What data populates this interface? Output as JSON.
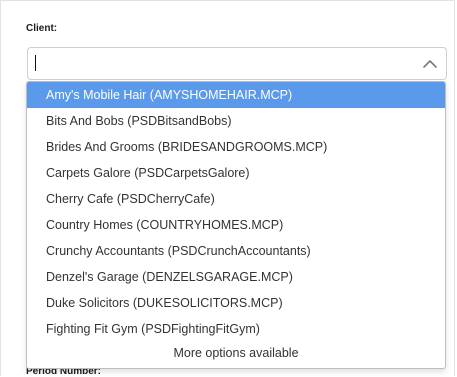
{
  "client_field": {
    "label": "Client:",
    "input_value": ""
  },
  "dropdown": {
    "selected_index": 0,
    "options": [
      "Amy's Mobile Hair (AMYSHOMEHAIR.MCP)",
      "Bits And Bobs (PSDBitsandBobs)",
      "Brides And Grooms (BRIDESANDGROOMS.MCP)",
      "Carpets Galore (PSDCarpetsGalore)",
      "Cherry Cafe (PSDCherryCafe)",
      "Country Homes (COUNTRYHOMES.MCP)",
      "Crunchy Accountants (PSDCrunchAccountants)",
      "Denzel's Garage (DENZELSGARAGE.MCP)",
      "Duke Solicitors (DUKESOLICITORS.MCP)",
      "Fighting Fit Gym (PSDFightingFitGym)"
    ],
    "more_text": "More options available"
  },
  "next_field": {
    "label": "Period Number:"
  },
  "colors": {
    "highlight": "#5b9aeb"
  },
  "icons": {
    "toggle": "chevron-up-icon"
  }
}
